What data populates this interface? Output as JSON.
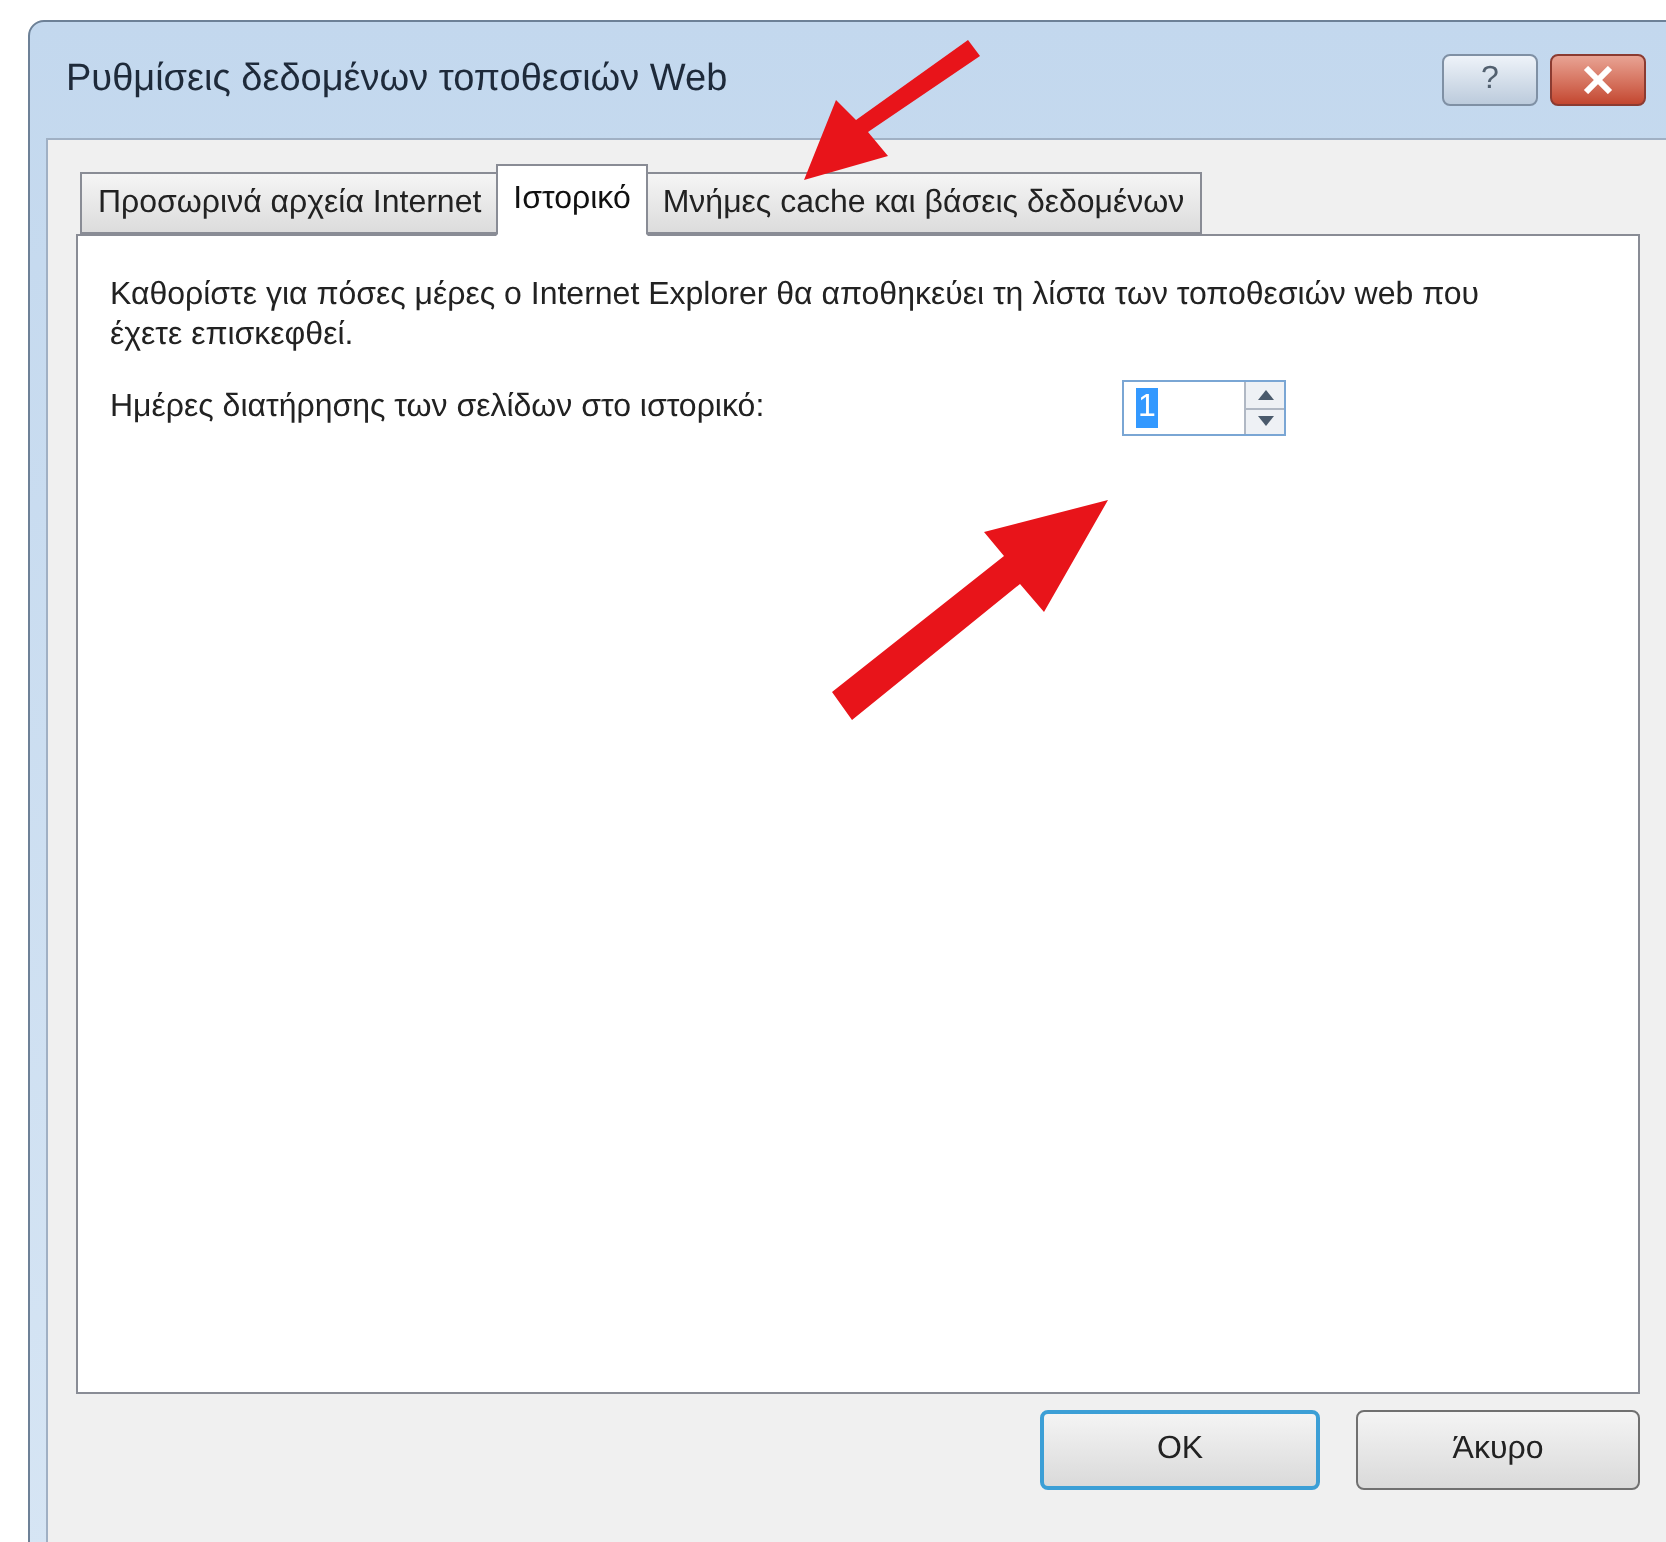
{
  "window": {
    "title": "Ρυθμίσεις δεδομένων τοποθεσιών Web",
    "help_button": "?"
  },
  "tabs": [
    {
      "label": "Προσωρινά αρχεία Internet",
      "selected": false
    },
    {
      "label": "Ιστορικό",
      "selected": true
    },
    {
      "label": "Μνήμες cache και βάσεις δεδομένων",
      "selected": false
    }
  ],
  "description": "Καθορίστε για πόσες μέρες ο Internet Explorer θα αποθηκεύει τη λίστα των τοποθεσιών web που έχετε επισκεφθεί.",
  "days_field": {
    "label": "Ημέρες διατήρησης των σελίδων στο ιστορικό:",
    "value": "1"
  },
  "buttons": [
    {
      "label": "OK",
      "selected": true
    },
    {
      "label": "Άκυρο",
      "selected": false
    }
  ]
}
